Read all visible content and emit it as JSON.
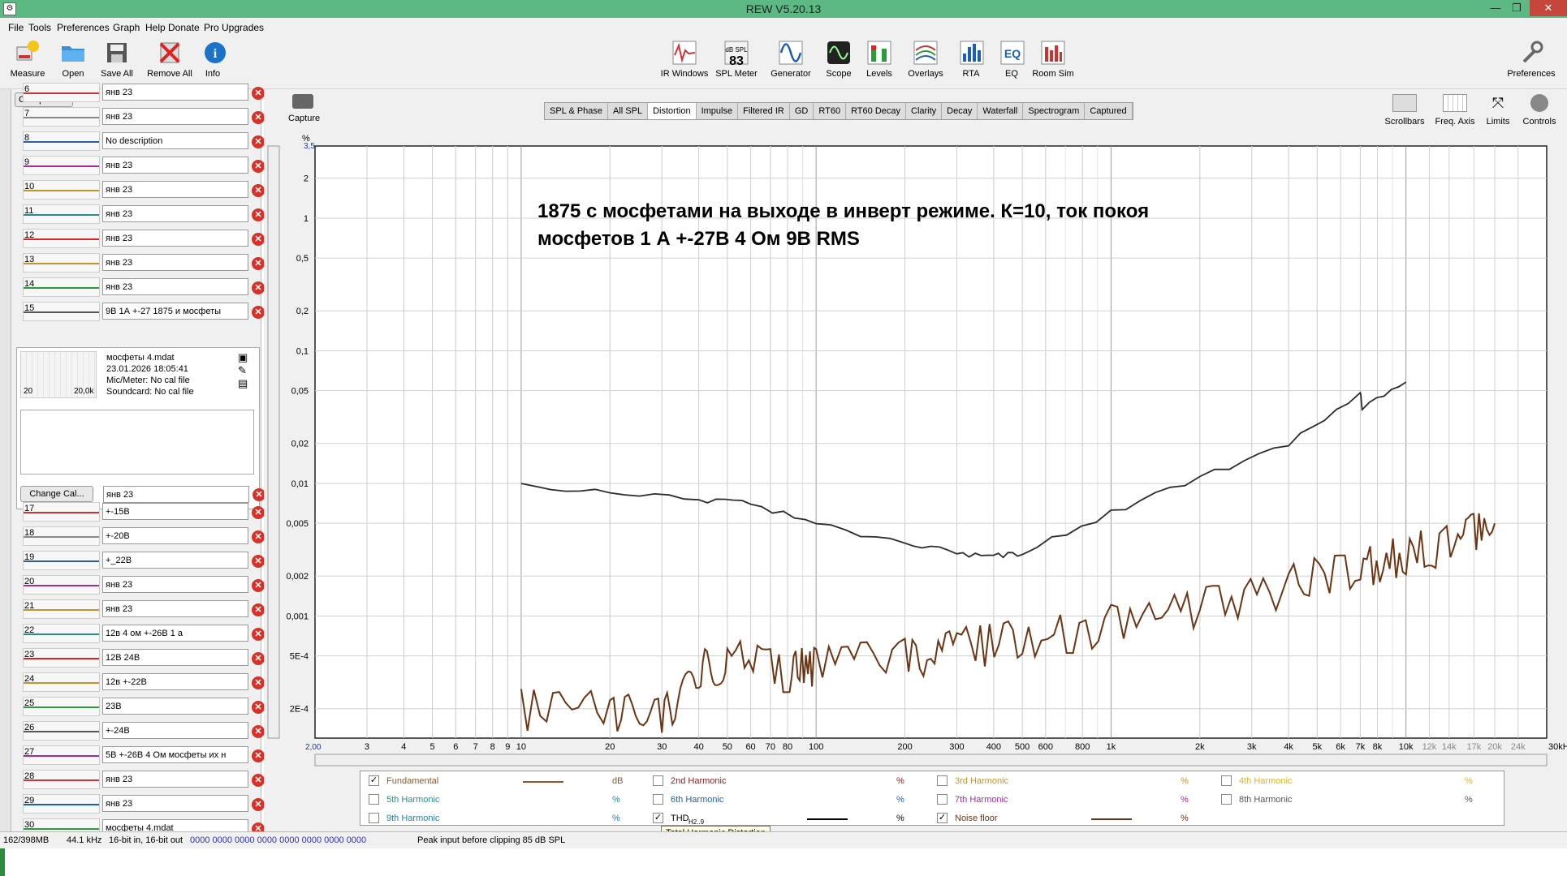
{
  "window": {
    "title": "REW V5.20.13",
    "min": "—",
    "max": "❐",
    "close": "✕"
  },
  "menu": [
    "File",
    "Tools",
    "Preferences",
    "Graph",
    "Help",
    "Donate",
    "Pro Upgrades"
  ],
  "toolbar": {
    "left": [
      "Measure",
      "Open",
      "Save All",
      "Remove All",
      "Info"
    ],
    "center": [
      "IR Windows",
      "SPL Meter",
      "Generator",
      "Scope",
      "Levels",
      "Overlays",
      "RTA",
      "EQ",
      "Room Sim"
    ],
    "right": "Preferences",
    "spl_meter_top": "dB SPL",
    "spl_meter_value": "83"
  },
  "graph_toolbar": {
    "capture": "Capture",
    "right": [
      "Scrollbars",
      "Freq. Axis",
      "Limits",
      "Controls"
    ]
  },
  "tabs": [
    "SPL & Phase",
    "All SPL",
    "Distortion",
    "Impulse",
    "Filtered IR",
    "GD",
    "RT60",
    "RT60 Decay",
    "Clarity",
    "Decay",
    "Waterfall",
    "Spectrogram",
    "Captured"
  ],
  "active_tab": "Distortion",
  "measurements_top": [
    {
      "num": "6",
      "desc": "янв 23"
    },
    {
      "num": "7",
      "desc": "янв 23"
    },
    {
      "num": "8",
      "desc": "No description"
    },
    {
      "num": "9",
      "desc": "янв 23"
    },
    {
      "num": "10",
      "desc": "янв 23"
    },
    {
      "num": "11",
      "desc": "янв 23"
    },
    {
      "num": "12",
      "desc": "янв 23"
    },
    {
      "num": "13",
      "desc": "янв 23"
    },
    {
      "num": "14",
      "desc": "янв 23"
    },
    {
      "num": "15",
      "desc": "9В  1А +-27 1875 и мосфеты"
    }
  ],
  "selected": {
    "num": "16",
    "file": "мосфеты 4.mdat",
    "date": "23.01.2026 18:05:41",
    "mic": "Mic/Meter: No cal file",
    "soundcard": "Soundcard: No cal file",
    "range_lo": "20",
    "range_hi": "20,0k",
    "change_cal": "Change Cal...",
    "desc": "янв 23"
  },
  "collapse": "Collapse",
  "measurements_bottom": [
    {
      "num": "17",
      "desc": "+-15В"
    },
    {
      "num": "18",
      "desc": "+-20В"
    },
    {
      "num": "19",
      "desc": "+_22В"
    },
    {
      "num": "20",
      "desc": "янв 23"
    },
    {
      "num": "21",
      "desc": "янв 23"
    },
    {
      "num": "22",
      "desc": "12в 4 ом +-26В 1 а"
    },
    {
      "num": "23",
      "desc": "12В 24В"
    },
    {
      "num": "24",
      "desc": "12в +-22В"
    },
    {
      "num": "25",
      "desc": "23В"
    },
    {
      "num": "26",
      "desc": "+-24В"
    },
    {
      "num": "27",
      "desc": "5В +-26В 4 Ом мосфеты их н"
    },
    {
      "num": "28",
      "desc": "янв 23"
    },
    {
      "num": "29",
      "desc": "янв 23"
    },
    {
      "num": "30",
      "desc": "мосфеты 4.mdat"
    }
  ],
  "chart_data": {
    "type": "line",
    "title": "1875 с мосфетами на выходе в инверт режиме. К=10, ток покоя",
    "subtitle": "мосфетов 1 А +-27В  4 Ом   9В RMS",
    "yunit": "%",
    "ytop": "3,5",
    "yticks": [
      "2",
      "1",
      "0,5",
      "0,2",
      "0,1",
      "0,05",
      "0,02",
      "0,01",
      "0,005",
      "0,002",
      "0,001",
      "5E-4",
      "2E-4"
    ],
    "yvals": [
      2,
      1,
      0.5,
      0.2,
      0.1,
      0.05,
      0.02,
      0.01,
      0.005,
      0.002,
      0.001,
      0.0005,
      0.0002
    ],
    "xstart": "2,00",
    "xend": "30kHz",
    "xticks": [
      "3",
      "4",
      "5",
      "6",
      "7",
      "8",
      "9",
      "10",
      "20",
      "30",
      "40",
      "50",
      "60",
      "70",
      "80",
      "100",
      "200",
      "300",
      "400",
      "500",
      "600",
      "800",
      "1k",
      "2k",
      "3k",
      "4k",
      "5k",
      "6k",
      "7k",
      "8k",
      "10k",
      "12k",
      "14k",
      "17k",
      "20k",
      "24k"
    ],
    "xvals": [
      3,
      4,
      5,
      6,
      7,
      8,
      9,
      10,
      20,
      30,
      40,
      50,
      60,
      70,
      80,
      100,
      200,
      300,
      400,
      500,
      600,
      800,
      1000,
      2000,
      3000,
      4000,
      5000,
      6000,
      7000,
      8000,
      10000,
      12000,
      14000,
      17000,
      20000,
      24000
    ],
    "xrange": [
      2,
      30000
    ],
    "yrange": [
      0.00012,
      3.5
    ],
    "yscale": "log",
    "xscale": "log",
    "series": [
      {
        "name": "THD",
        "color": "#2b2b2b",
        "points": [
          [
            10,
            0.0095
          ],
          [
            20,
            0.0085
          ],
          [
            40,
            0.0075
          ],
          [
            60,
            0.007
          ],
          [
            100,
            0.005
          ],
          [
            200,
            0.0035
          ],
          [
            300,
            0.003
          ],
          [
            400,
            0.0028
          ],
          [
            500,
            0.003
          ],
          [
            1000,
            0.006
          ],
          [
            2000,
            0.011
          ],
          [
            4000,
            0.02
          ],
          [
            7000,
            0.048
          ],
          [
            7100,
            0.036
          ],
          [
            10000,
            0.058
          ]
        ]
      },
      {
        "name": "Noise floor",
        "color": "#6b3414",
        "points": [
          [
            10,
            0.00021
          ],
          [
            20,
            0.0002
          ],
          [
            30,
            0.00018
          ],
          [
            40,
            0.0004
          ],
          [
            50,
            0.0005
          ],
          [
            80,
            0.0004
          ],
          [
            100,
            0.00045
          ],
          [
            200,
            0.0005
          ],
          [
            300,
            0.0006
          ],
          [
            500,
            0.0007
          ],
          [
            1000,
            0.0009
          ],
          [
            2000,
            0.0012
          ],
          [
            4000,
            0.0018
          ],
          [
            7000,
            0.0025
          ],
          [
            10000,
            0.003
          ],
          [
            15000,
            0.004
          ],
          [
            20000,
            0.005
          ]
        ]
      }
    ]
  },
  "legend": [
    {
      "label": "Fundamental",
      "checked": true,
      "unit": "dB",
      "color": "#8b5a2b",
      "line": true
    },
    {
      "label": "2nd Harmonic",
      "checked": false,
      "unit": "%",
      "color": "#8b1a1a"
    },
    {
      "label": "3rd Harmonic",
      "checked": false,
      "unit": "%",
      "color": "#c8922a"
    },
    {
      "label": "4th Harmonic",
      "checked": false,
      "unit": "%",
      "color": "#d9b530"
    },
    {
      "label": "5th Harmonic",
      "checked": false,
      "unit": "%",
      "color": "#2e8b8b"
    },
    {
      "label": "6th Harmonic",
      "checked": false,
      "unit": "%",
      "color": "#2a5f9e"
    },
    {
      "label": "7th Harmonic",
      "checked": false,
      "unit": "%",
      "color": "#9c2f9c"
    },
    {
      "label": "8th Harmonic",
      "checked": false,
      "unit": "%",
      "color": "#555555"
    },
    {
      "label": "9th Harmonic",
      "checked": false,
      "unit": "%",
      "color": "#2a7f9e"
    },
    {
      "label": "THD",
      "sub": "H2..9",
      "checked": true,
      "unit": "%",
      "color": "#000000",
      "line": true
    },
    {
      "label": "Noise floor",
      "checked": true,
      "unit": "%",
      "color": "#6b3414",
      "line": true
    }
  ],
  "tooltip": "Total Harmonic Distortion",
  "status": {
    "mem": "162/398MB",
    "rate": "44.1 kHz",
    "bits": "16-bit in, 16-bit out",
    "levels": "0000 0000  0000 0000  0000 0000  0000 0000",
    "peak": "Peak input before clipping 85 dB SPL"
  }
}
